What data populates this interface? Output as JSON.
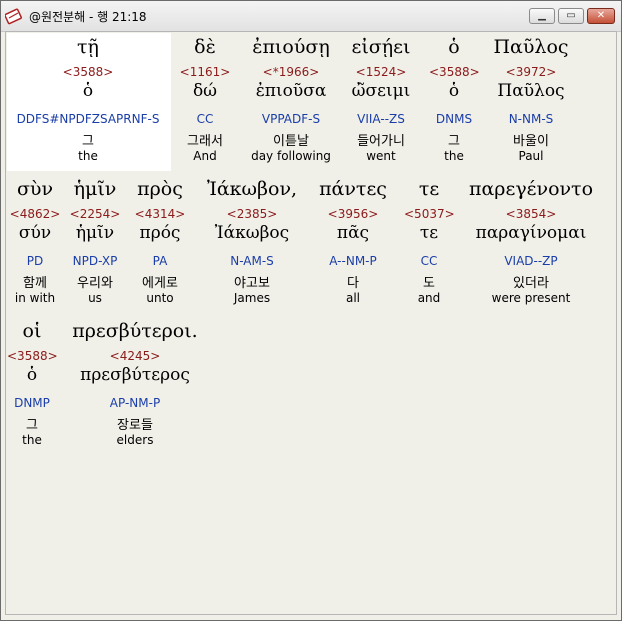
{
  "window": {
    "title": "@원전분해 - 행 21:18"
  },
  "rows": [
    [
      {
        "greek": "τῇ",
        "strong": "<3588>",
        "lemma": "ὁ",
        "parse": "DDFS#NPDFZSAPRNF-S",
        "korean": "그",
        "english": "the"
      },
      {
        "greek": "δὲ",
        "strong": "<1161>",
        "lemma": "δώ",
        "parse": "CC",
        "korean": "그래서",
        "english": "And"
      },
      {
        "greek": "ἐπιούσῃ",
        "strong": "<*1966>",
        "lemma": "ἐπιοῦσα",
        "parse": "VPPADF-S",
        "korean": "이튿날",
        "english": "day following"
      },
      {
        "greek": "εἰσῄει",
        "strong": "<1524>",
        "lemma": "ὠ̃σειμι",
        "parse": "VIIA--ZS",
        "korean": "들어가니",
        "english": "went"
      },
      {
        "greek": "ὁ",
        "strong": "<3588>",
        "lemma": "ὁ",
        "parse": "DNMS",
        "korean": "그",
        "english": "the"
      },
      {
        "greek": "Παῦλος",
        "strong": "<3972>",
        "lemma": "Παῦλος",
        "parse": "N-NM-S",
        "korean": "바울이",
        "english": "Paul"
      }
    ],
    [
      {
        "greek": "σὺν",
        "strong": "<4862>",
        "lemma": "σύν",
        "parse": "PD",
        "korean": "함께",
        "english": "in with"
      },
      {
        "greek": "ἡμῖν",
        "strong": "<2254>",
        "lemma": "ἡμῖν",
        "parse": "NPD-XP",
        "korean": "우리와",
        "english": "us"
      },
      {
        "greek": "πρὸς",
        "strong": "<4314>",
        "lemma": "πρός",
        "parse": "PA",
        "korean": "에게로",
        "english": "unto"
      },
      {
        "greek": "Ἰάκωβον,",
        "strong": "<2385>",
        "lemma": "Ἰάκωβος",
        "parse": "N-AM-S",
        "korean": "야고보",
        "english": "James"
      },
      {
        "greek": "πάντες",
        "strong": "<3956>",
        "lemma": "πᾶς",
        "parse": "A--NM-P",
        "korean": "다",
        "english": "all"
      },
      {
        "greek": "τε",
        "strong": "<5037>",
        "lemma": "τε",
        "parse": "CC",
        "korean": "도",
        "english": "and"
      },
      {
        "greek": "παρεγένοντο",
        "strong": "<3854>",
        "lemma": "παραγίνομαι",
        "parse": "VIAD--ZP",
        "korean": "있더라",
        "english": "were present"
      }
    ],
    [
      {
        "greek": "οἱ",
        "strong": "<3588>",
        "lemma": "ὁ",
        "parse": "DNMP",
        "korean": "그",
        "english": "the"
      },
      {
        "greek": "πρεσβύτεροι.",
        "strong": "<4245>",
        "lemma": "πρεσβύτερος",
        "parse": "AP-NM-P",
        "korean": "장로들",
        "english": "elders"
      }
    ]
  ]
}
